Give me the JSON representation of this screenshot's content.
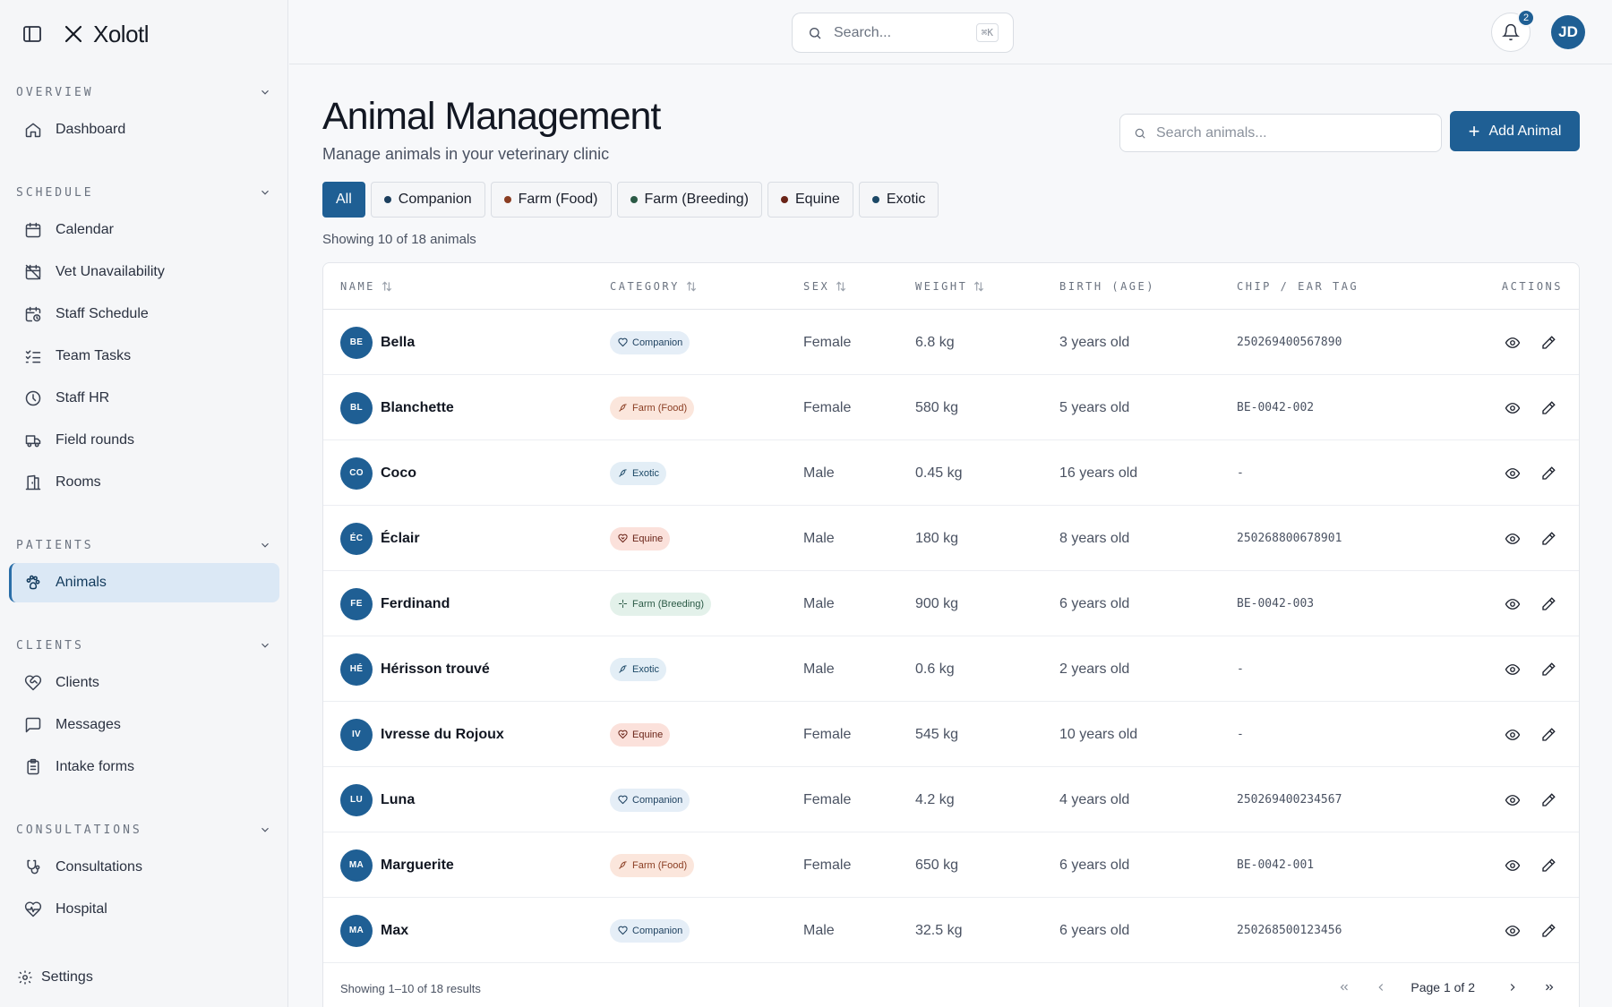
{
  "app": {
    "name": "Xolotl"
  },
  "sidebar": {
    "sections": [
      {
        "label": "OVERVIEW",
        "items": [
          {
            "label": "Dashboard",
            "icon": "home-icon"
          }
        ]
      },
      {
        "label": "SCHEDULE",
        "items": [
          {
            "label": "Calendar",
            "icon": "calendar-icon"
          },
          {
            "label": "Vet Unavailability",
            "icon": "calendar-off-icon"
          },
          {
            "label": "Staff Schedule",
            "icon": "calendar-clock-icon"
          },
          {
            "label": "Team Tasks",
            "icon": "list-checks-icon"
          },
          {
            "label": "Staff HR",
            "icon": "clock-icon"
          },
          {
            "label": "Field rounds",
            "icon": "truck-icon"
          },
          {
            "label": "Rooms",
            "icon": "door-icon"
          }
        ]
      },
      {
        "label": "PATIENTS",
        "items": [
          {
            "label": "Animals",
            "icon": "paw-icon",
            "active": true
          }
        ]
      },
      {
        "label": "CLIENTS",
        "items": [
          {
            "label": "Clients",
            "icon": "heart-handshake-icon"
          },
          {
            "label": "Messages",
            "icon": "message-square-icon"
          },
          {
            "label": "Intake forms",
            "icon": "clipboard-icon"
          }
        ]
      },
      {
        "label": "CONSULTATIONS",
        "items": [
          {
            "label": "Consultations",
            "icon": "stethoscope-icon"
          },
          {
            "label": "Hospital",
            "icon": "heart-pulse-icon"
          }
        ]
      }
    ],
    "settings_label": "Settings"
  },
  "topbar": {
    "search_placeholder": "Search...",
    "search_shortcut": "⌘K",
    "notifications_count": "2",
    "user_initials": "JD"
  },
  "page": {
    "title": "Animal Management",
    "subtitle": "Manage animals in your veterinary clinic",
    "search_placeholder": "Search animals...",
    "add_label": "Add Animal",
    "showing": "Showing 10 of 18 animals"
  },
  "filters": [
    {
      "label": "All",
      "active": true,
      "dot": ""
    },
    {
      "label": "Companion",
      "dot": "#1c3f5e"
    },
    {
      "label": "Farm (Food)",
      "dot": "#8a3d22"
    },
    {
      "label": "Farm (Breeding)",
      "dot": "#2b5a46"
    },
    {
      "label": "Equine",
      "dot": "#6a2418"
    },
    {
      "label": "Exotic",
      "dot": "#1c4866"
    }
  ],
  "table": {
    "headers": {
      "name": "NAME",
      "category": "CATEGORY",
      "sex": "SEX",
      "weight": "WEIGHT",
      "birth": "BIRTH (AGE)",
      "chip": "CHIP / EAR TAG",
      "actions": "ACTIONS"
    },
    "categories": {
      "Companion": {
        "bg": "#e5eef7",
        "fg": "#1c3f5e",
        "icon": "heart-icon"
      },
      "Farm (Food)": {
        "bg": "#fbe6dc",
        "fg": "#8a3d22",
        "icon": "feather-icon"
      },
      "Exotic": {
        "bg": "#e3eef6",
        "fg": "#1c4866",
        "icon": "feather-icon"
      },
      "Equine": {
        "bg": "#fbe1db",
        "fg": "#6a2418",
        "icon": "heart-shield-icon"
      },
      "Farm (Breeding)": {
        "bg": "#e3f1ea",
        "fg": "#2b5a46",
        "icon": "sparkle-icon"
      }
    },
    "rows": [
      {
        "initials": "BE",
        "name": "Bella",
        "category": "Companion",
        "sex": "Female",
        "weight": "6.8 kg",
        "age": "3 years old",
        "chip": "250269400567890"
      },
      {
        "initials": "BL",
        "name": "Blanchette",
        "category": "Farm (Food)",
        "sex": "Female",
        "weight": "580 kg",
        "age": "5 years old",
        "chip": "BE-0042-002"
      },
      {
        "initials": "CO",
        "name": "Coco",
        "category": "Exotic",
        "sex": "Male",
        "weight": "0.45 kg",
        "age": "16 years old",
        "chip": "-"
      },
      {
        "initials": "ÉC",
        "name": "Éclair",
        "category": "Equine",
        "sex": "Male",
        "weight": "180 kg",
        "age": "8 years old",
        "chip": "250268800678901"
      },
      {
        "initials": "FE",
        "name": "Ferdinand",
        "category": "Farm (Breeding)",
        "sex": "Male",
        "weight": "900 kg",
        "age": "6 years old",
        "chip": "BE-0042-003"
      },
      {
        "initials": "HÉ",
        "name": "Hérisson trouvé",
        "category": "Exotic",
        "sex": "Male",
        "weight": "0.6 kg",
        "age": "2 years old",
        "chip": "-"
      },
      {
        "initials": "IV",
        "name": "Ivresse du Rojoux",
        "category": "Equine",
        "sex": "Female",
        "weight": "545 kg",
        "age": "10 years old",
        "chip": "-"
      },
      {
        "initials": "LU",
        "name": "Luna",
        "category": "Companion",
        "sex": "Female",
        "weight": "4.2 kg",
        "age": "4 years old",
        "chip": "250269400234567"
      },
      {
        "initials": "MA",
        "name": "Marguerite",
        "category": "Farm (Food)",
        "sex": "Female",
        "weight": "650 kg",
        "age": "6 years old",
        "chip": "BE-0042-001"
      },
      {
        "initials": "MA",
        "name": "Max",
        "category": "Companion",
        "sex": "Male",
        "weight": "32.5 kg",
        "age": "6 years old",
        "chip": "250268500123456"
      }
    ],
    "footer": {
      "results": "Showing 1–10 of 18 results",
      "page_info": "Page 1 of 2"
    }
  }
}
